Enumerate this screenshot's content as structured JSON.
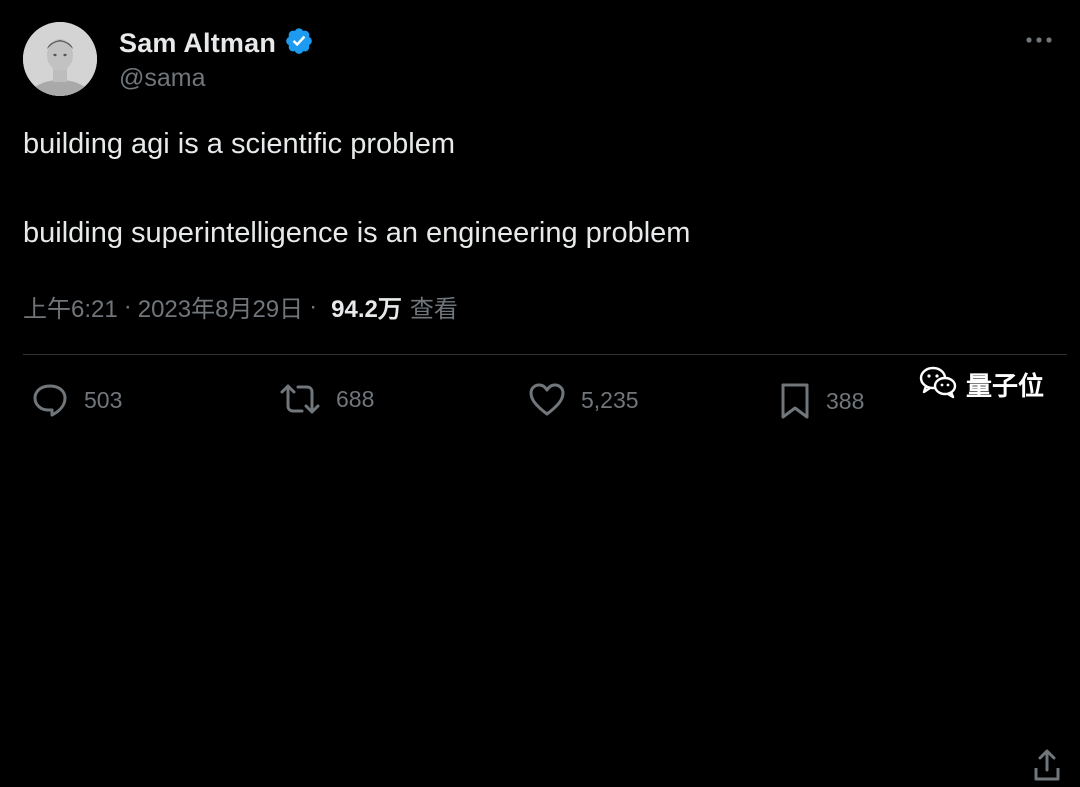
{
  "author": {
    "name": "Sam Altman",
    "handle": "@sama",
    "verified": true
  },
  "tweet": {
    "line1": "building agi is a scientific problem",
    "line2": "building superintelligence is an engineering problem"
  },
  "meta": {
    "time": "上午6:21",
    "separator1": "·",
    "date": "2023年8月29日",
    "separator2": "·",
    "views": "94.2万",
    "views_label": "查看"
  },
  "actions": {
    "replies": "503",
    "reposts": "688",
    "likes": "5,235",
    "bookmarks": "388"
  },
  "watermark": {
    "text": "量子位"
  },
  "colors": {
    "background": "#000000",
    "text": "#e7e9ea",
    "muted": "#71767b",
    "verified": "#1d9bf0"
  }
}
